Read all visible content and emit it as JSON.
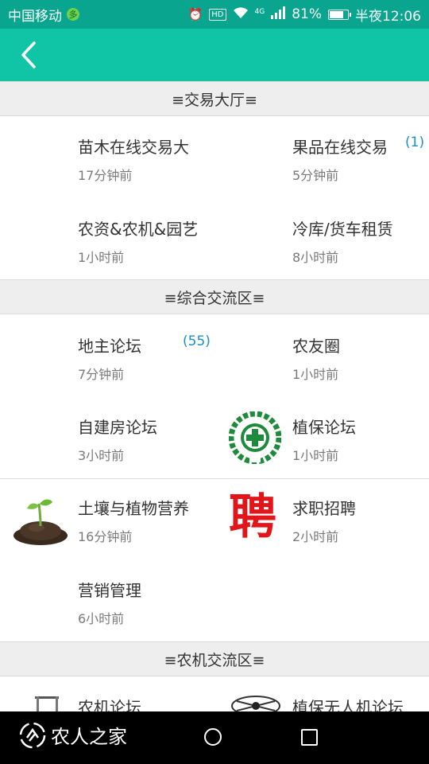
{
  "status_bar": {
    "carrier": "中国移动",
    "carrier_badge": "多",
    "signal_label": "4G",
    "battery": "81%",
    "battery_level": 0.81,
    "time": "半夜12:06"
  },
  "sections": [
    {
      "title": "≡交易大厅≡"
    },
    {
      "title": "≡综合交流区≡"
    },
    {
      "title": "≡农机交流区≡"
    }
  ],
  "forums": [
    {
      "title": "苗木在线交易大",
      "time": "17分钟前",
      "badge": ""
    },
    {
      "title": "果品在线交易",
      "time": "5分钟前",
      "badge": "(1)"
    },
    {
      "title": "农资&农机&园艺",
      "time": "1小时前",
      "badge": ""
    },
    {
      "title": "冷库/货车租赁",
      "time": "8小时前",
      "badge": ""
    },
    {
      "title": "地主论坛",
      "time": "7分钟前",
      "badge": "(55)"
    },
    {
      "title": "农友圈",
      "time": "1小时前",
      "badge": ""
    },
    {
      "title": "自建房论坛",
      "time": "3小时前",
      "badge": ""
    },
    {
      "title": "植保论坛",
      "time": "1小时前",
      "badge": ""
    },
    {
      "title": "土壤与植物营养",
      "time": "16分钟前",
      "badge": ""
    },
    {
      "title": "求职招聘",
      "time": "2小时前",
      "badge": ""
    },
    {
      "title": "营销管理",
      "time": "6小时前",
      "badge": ""
    },
    {
      "title": "农机论坛",
      "time": "",
      "badge": ""
    },
    {
      "title": "植保无人机论坛",
      "time": "",
      "badge": ""
    }
  ],
  "icons": {
    "plant_protection": "plant-protection-emblem",
    "soil": "seedling-soil-icon",
    "recruit": "聘",
    "tractor": "tractor-icon",
    "drone": "drone-icon"
  },
  "nav": {
    "logo_text": "农人之家"
  },
  "colors": {
    "status_bar": "#0aa58f",
    "app_bar": "#10c4a6",
    "badge": "#1b8ed0",
    "recruit": "#e0161b",
    "emblem": "#1e8b3c"
  }
}
